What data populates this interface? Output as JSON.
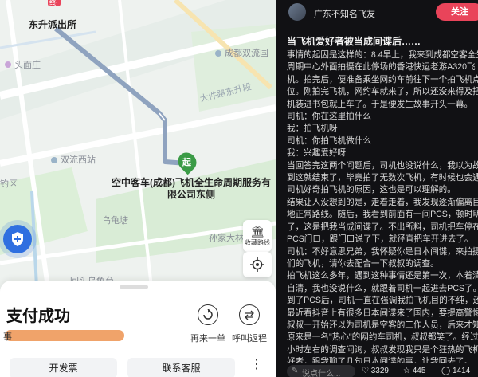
{
  "map": {
    "station_title": "东升派出所",
    "destination": "空中客车(成都)飞机全生命周期服务有限公司东侧",
    "start_marker": "起",
    "labels": {
      "toumianzhuang": "头面庄",
      "chengdu_shuangliu": "成都双流国",
      "datongluroad": "大件路东升段",
      "shuangliu_west": "双流西站",
      "diaoyao": "钓区",
      "wuguitang": "乌龟塘",
      "sunjia": "孙家大林",
      "huishengqiao": "回头乌龟台"
    },
    "icon_names": {
      "shield": "shield-icon",
      "favorite": "building-icon",
      "locate": "locate-icon"
    },
    "fav_label": "收藏路线",
    "top_tag": "终"
  },
  "sheet": {
    "pay_title": "支付成功",
    "redact_prefix": "事",
    "actions": [
      {
        "label": "再来一单",
        "icon": "repeat-order-icon"
      },
      {
        "label": "呼叫返程",
        "icon": "return-trip-icon"
      }
    ],
    "invoice_label": "开发票",
    "service_label": "联系客服",
    "more_label": "⋮"
  },
  "post": {
    "author": "广东不知名飞友",
    "follow_label": "关注",
    "title": "当飞机爱好者被当成间谍后……",
    "lines": [
      "事情的起因是这样的：8.4早上，我来到成都空客全生命",
      "周期中心外面拍摄在此停场的香港快运老游A320飞",
      "机。拍完后，便准备乘坐网约车前往下一个拍飞机点",
      "位。刚拍完飞机，网约车就来了，所以还没来得及把相",
      "机装进书包就上车了。于是便发生故事开头一幕。",
      "司机：你在这里拍什么",
      "我：拍飞机呀",
      "司机：你拍飞机做什么",
      "我：兴趣爱好呀",
      "当回答完这两个问题后，司机也没说什么，我以为故事",
      "到这就结束了，毕竟拍了无数次飞机，有时候也会遇到",
      "司机好奇拍飞机的原因，这也是可以理解的。",
      "结果让人没想到的是，走着走着，我发现逐渐偏离目的",
      "地正常路线。随后，我看到前面有一间PCS，顿时明白",
      "了，这是把我当成间谍了。不出所料，司机把车停在",
      "PCS门口，跟门口说了下，就径直把车开进去了。",
      "司机：不好意思兄弟，我怀疑你是日本间谍，来拍摄我",
      "们的飞机，请你去配合一下叔叔的调查。",
      "拍飞机这么多年，遇到这种事情还是第一次，本着清者",
      "自清，我也没说什么，就跟着司机一起进去PCS了。",
      "到了PCS后，司机一直在强调我拍飞机目的不纯，还说",
      "最近看抖音上有很多日本间谍来了国内，要提高警惕。",
      "叔叔一开始还以为司机是空客的工作人员，后来才知道",
      "原来是一名\"热心\"的网约车司机，叔叔都笑了。经过半",
      "小时左右的调查问询，叔叔发现我只是个狂热的飞机爱",
      "好者，跟我聊了几句日本间谍的事，让我回去了。"
    ],
    "comment_placeholder": "说点什么...",
    "likes": "3329",
    "stars": "445",
    "comments": "1414"
  },
  "colors": {
    "route": "#8fa3bf",
    "accent_red": "#e9445a",
    "start_green": "#3b9b46",
    "shield_blue": "#2f6fe0"
  }
}
